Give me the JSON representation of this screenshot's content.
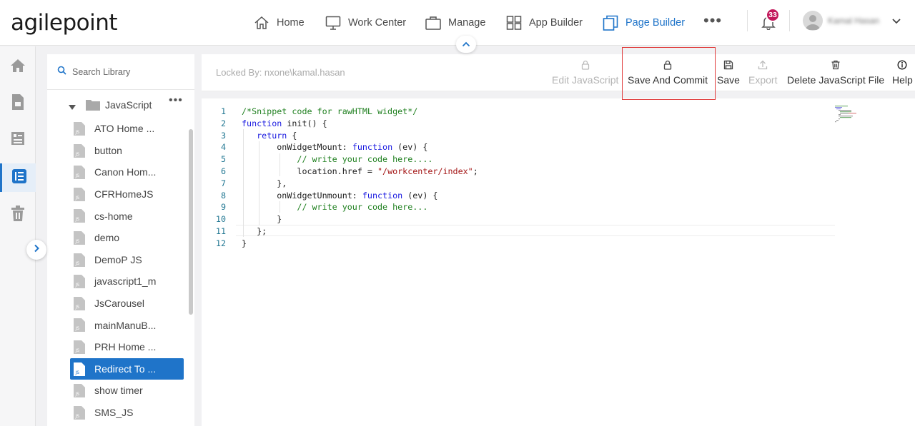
{
  "brand": {
    "logo_text": "agilepoint"
  },
  "nav": {
    "home": "Home",
    "work_center": "Work Center",
    "manage": "Manage",
    "app_builder": "App Builder",
    "page_builder": "Page Builder",
    "more": "•••",
    "notification_count": "33",
    "user_name": "Kamal Hasan"
  },
  "library": {
    "search_placeholder": "Search Library",
    "folder_label": "JavaScript",
    "folder_menu": "•••",
    "files": [
      {
        "label": "ATO Home ..."
      },
      {
        "label": "button"
      },
      {
        "label": "Canon Hom..."
      },
      {
        "label": "CFRHomeJS"
      },
      {
        "label": "cs-home"
      },
      {
        "label": "demo"
      },
      {
        "label": "DemoP JS"
      },
      {
        "label": "javascript1_m"
      },
      {
        "label": "JsCarousel"
      },
      {
        "label": "mainManuB..."
      },
      {
        "label": "PRH Home ..."
      },
      {
        "label": "Redirect To ..."
      },
      {
        "label": "show timer"
      },
      {
        "label": "SMS_JS"
      }
    ],
    "selected_index": 11
  },
  "toolbar": {
    "locked_by": "Locked By: nxone\\kamal.hasan",
    "edit_js": "Edit JavaScript",
    "save_commit": "Save And Commit",
    "save": "Save",
    "export": "Export",
    "delete_js": "Delete JavaScript File",
    "help": "Help"
  },
  "editor": {
    "line_numbers": [
      "1",
      "2",
      "3",
      "4",
      "5",
      "6",
      "7",
      "8",
      "9",
      "10",
      "11",
      "12"
    ],
    "lines": [
      [
        {
          "t": "/*Snippet code for rawHTML widget*/",
          "c": "com"
        }
      ],
      [
        {
          "t": "function",
          "c": "kw"
        },
        {
          "t": " init() {"
        }
      ],
      [
        {
          "t": "   "
        },
        {
          "t": "return",
          "c": "kw"
        },
        {
          "t": " {"
        }
      ],
      [
        {
          "t": "       onWidgetMount: "
        },
        {
          "t": "function",
          "c": "kw"
        },
        {
          "t": " (ev) {"
        }
      ],
      [
        {
          "t": "           "
        },
        {
          "t": "// write your code here....",
          "c": "com"
        }
      ],
      [
        {
          "t": "           location.href = "
        },
        {
          "t": "\"/workcenter/index\"",
          "c": "str"
        },
        {
          "t": ";"
        }
      ],
      [
        {
          "t": "       },"
        }
      ],
      [
        {
          "t": "       onWidgetUnmount: "
        },
        {
          "t": "function",
          "c": "kw"
        },
        {
          "t": " (ev) {"
        }
      ],
      [
        {
          "t": "           "
        },
        {
          "t": "// write your code here...",
          "c": "com"
        }
      ],
      [
        {
          "t": "       }"
        }
      ],
      [
        {
          "t": "   };"
        }
      ],
      [
        {
          "t": "}"
        }
      ]
    ]
  },
  "colors": {
    "accent": "#1f74c9",
    "badge": "#c2185b",
    "highlight": "#e03a3a",
    "comment": "#208020",
    "keyword": "#1a1ae0",
    "string": "#a31515"
  }
}
